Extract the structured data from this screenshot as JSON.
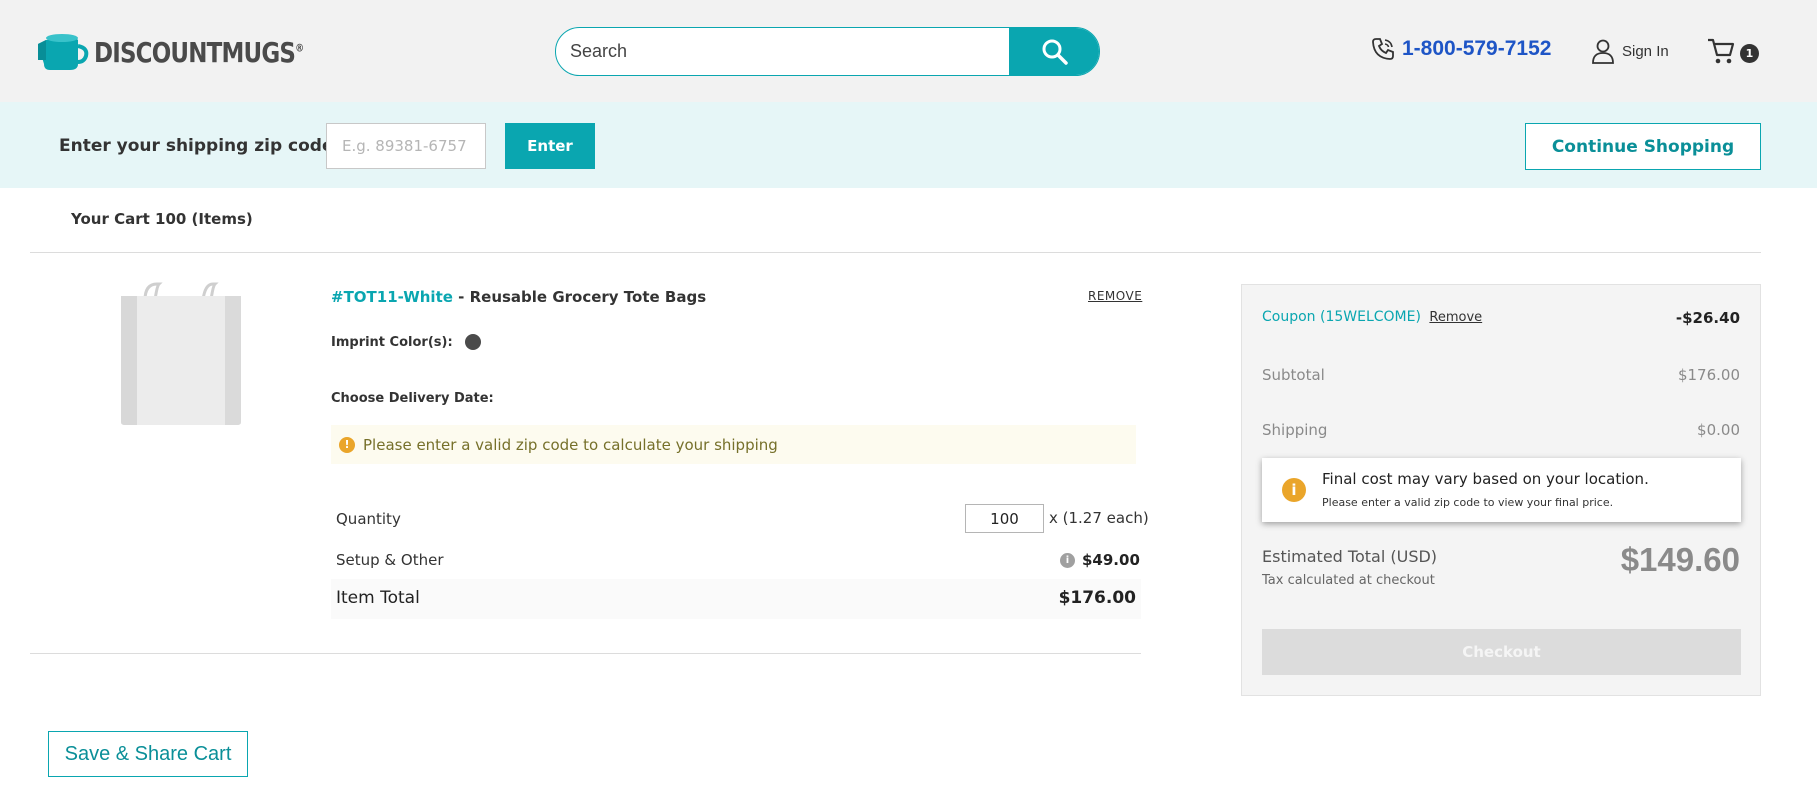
{
  "header": {
    "logo_text": "DISCOUNTMUGS",
    "logo_mark": "®",
    "search_placeholder": "Search",
    "phone": "1-800-579-7152",
    "sign_in": "Sign In",
    "cart_count": "1",
    "accent_color": "#0aa6b0"
  },
  "zip_bar": {
    "label": "Enter your shipping zip code:",
    "placeholder": "E.g. 89381-6757",
    "enter_label": "Enter",
    "continue_label": "Continue Shopping"
  },
  "cart": {
    "title": "Your Cart 100 (Items)"
  },
  "item": {
    "sku": "#TOT11-White",
    "separator": " - ",
    "name": "Reusable Grocery Tote Bags",
    "remove_label": "REMOVE",
    "imprint_label": "Imprint Color(s):",
    "imprint_color": "#4b4b4b",
    "delivery_label": "Choose Delivery Date:",
    "zip_warning": "Please enter a valid zip code to calculate your shipping",
    "quantity_label": "Quantity",
    "quantity_value": "100",
    "each_price": "x (1.27 each)",
    "setup_label": "Setup & Other",
    "setup_value": "$49.00",
    "total_label": "Item Total",
    "total_value": "$176.00"
  },
  "save_share_label": "Save & Share Cart",
  "summary": {
    "coupon_label": "Coupon (15WELCOME)",
    "coupon_remove": "Remove",
    "coupon_value": "-$26.40",
    "subtotal_label": "Subtotal",
    "subtotal_value": "$176.00",
    "shipping_label": "Shipping",
    "shipping_value": "$0.00",
    "notice_title": "Final cost may vary based on your location.",
    "notice_sub": "Please enter a valid zip code to view your final price.",
    "estimated_label": "Estimated Total (USD)",
    "tax_note": "Tax calculated at checkout",
    "estimated_value": "$149.60",
    "checkout_label": "Checkout"
  },
  "icons": {
    "search": "search-icon",
    "phone": "phone-icon",
    "user": "user-icon",
    "cart": "cart-icon",
    "warning": "warning-icon",
    "info": "info-icon"
  }
}
